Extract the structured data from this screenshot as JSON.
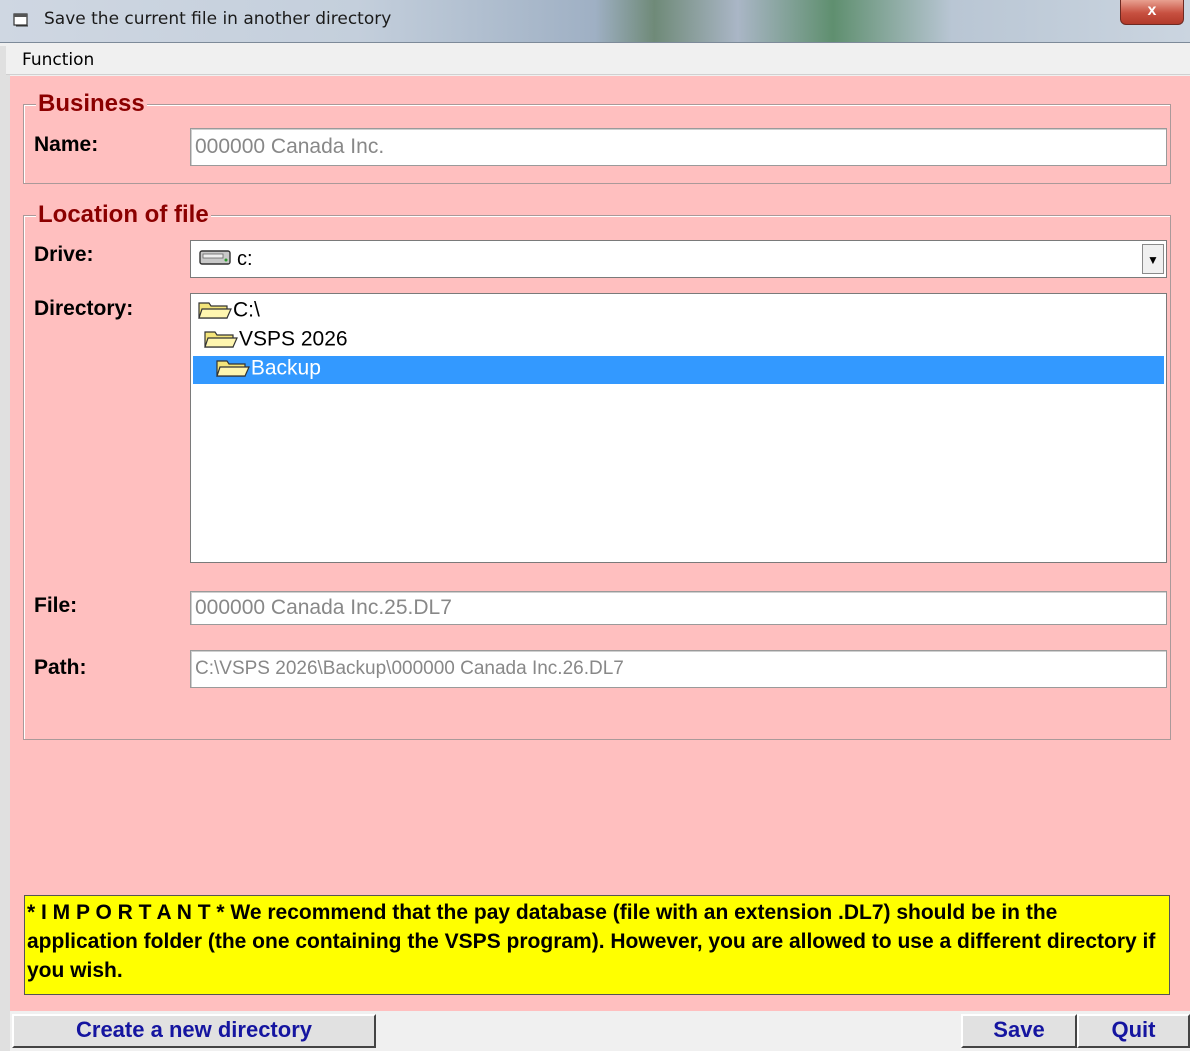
{
  "window": {
    "title": "Save the current file in another directory",
    "close_label": "x"
  },
  "menu": {
    "function_label": "Function"
  },
  "business": {
    "legend": "Business",
    "name_label": "Name:",
    "name_value": "000000 Canada Inc."
  },
  "location": {
    "legend": "Location of file",
    "drive_label": "Drive:",
    "drive_value": "c:",
    "directory_label": "Directory:",
    "directories": [
      "C:\\",
      "VSPS 2026",
      "Backup"
    ],
    "selected_directory": "Backup",
    "file_label": "File:",
    "file_value": "000000 Canada Inc.25.DL7",
    "path_label": "Path:",
    "path_value": "C:\\VSPS 2026\\Backup\\000000 Canada Inc.26.DL7"
  },
  "notice": {
    "text": "* I M P O R T A N T *  We recommend that the pay database (file with an extension .DL7) should be in the application folder (the one containing the VSPS program). However, you are allowed to use a different directory if you wish."
  },
  "buttons": {
    "create_dir": "Create a new directory",
    "save": "Save",
    "quit": "Quit"
  },
  "colors": {
    "form_bg": "#ffbfbf",
    "legend": "#8b0000",
    "notice_bg": "#ffff00",
    "button_text": "#1515a0",
    "selection": "#3399ff"
  }
}
